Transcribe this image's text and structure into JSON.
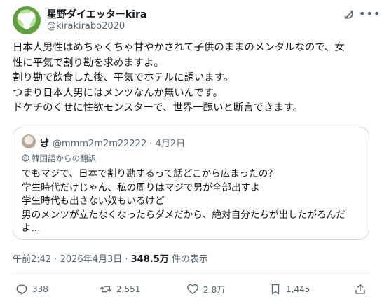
{
  "author": {
    "name": "星野ダイエッターkira",
    "handle": "@kirakirabo2020"
  },
  "post": {
    "lines": [
      "日本人男性はめちゃくちゃ甘やかされて子供のままのメンタルなので、女",
      "性に平気で割り勘を求めますよ。",
      "割り勘で飲食した後、平気でホテルに誘います。",
      "つまり日本人男にはメンツなんか無いんです。",
      "ドケチのくせに性欲モンスターで、世界一醜いと断言できます。"
    ]
  },
  "quote": {
    "name": "냥",
    "handle_date": "@mmm2m2m22222 · 4月2日",
    "translated_label": "韓国語からの翻訳",
    "lines": [
      "でもマジで、日本で割り勘するって話どこから広まったの？",
      "学生時代だけじゃん、私の周りはマジで男が全部出すよ",
      "学生時代も出さない奴もいるけど",
      "男のメンツが立たなくなったらダメだから、絶対自分たちが出したがるんだ",
      "よ..."
    ]
  },
  "meta": {
    "time_date": "午前2:42 · 2026年4月3日 · ",
    "views": "348.5万",
    "views_suffix": " 件の表示"
  },
  "actions": {
    "replies": "338",
    "reposts": "2,551",
    "likes": "2.8万",
    "bookmarks": "1,445"
  },
  "colors": {
    "text": "#0f1419",
    "secondary": "#536471",
    "border": "#cfd9de"
  }
}
